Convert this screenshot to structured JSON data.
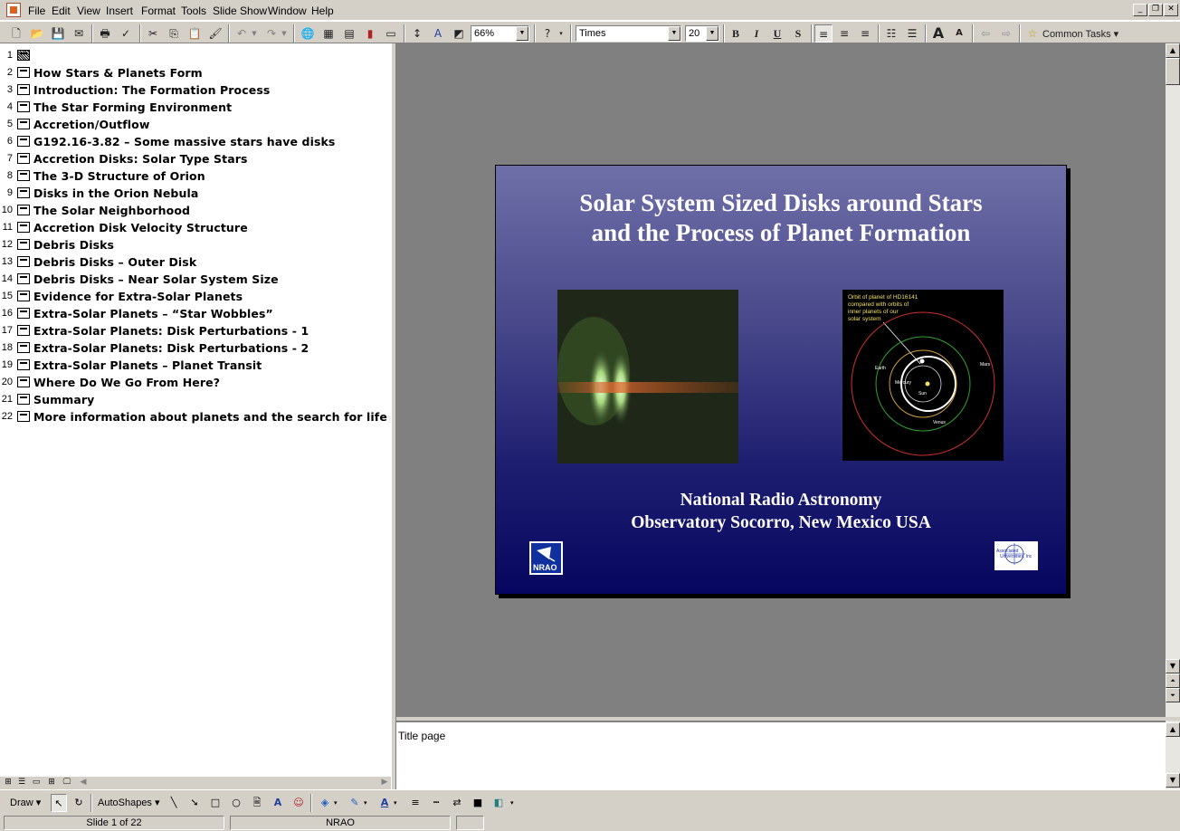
{
  "menubar": {
    "items": [
      "File",
      "Edit",
      "View",
      "Insert",
      "Format",
      "Tools",
      "Slide Show",
      "Window",
      "Help"
    ]
  },
  "toolbar": {
    "zoom": "66%",
    "font_name": "Times",
    "font_size": "20",
    "common_tasks": "Common Tasks"
  },
  "outline": {
    "slides": [
      {
        "num": "1",
        "title": ""
      },
      {
        "num": "2",
        "title": "How Stars & Planets Form"
      },
      {
        "num": "3",
        "title": "Introduction: The Formation Process"
      },
      {
        "num": "4",
        "title": "The Star Forming Environment"
      },
      {
        "num": "5",
        "title": "Accretion/Outflow"
      },
      {
        "num": "6",
        "title": "G192.16-3.82 – Some massive stars have disks"
      },
      {
        "num": "7",
        "title": "Accretion Disks: Solar Type Stars"
      },
      {
        "num": "8",
        "title": "The 3-D Structure of Orion"
      },
      {
        "num": "9",
        "title": "Disks in the Orion Nebula"
      },
      {
        "num": "10",
        "title": "The Solar Neighborhood"
      },
      {
        "num": "11",
        "title": "Accretion Disk Velocity Structure"
      },
      {
        "num": "12",
        "title": "Debris Disks"
      },
      {
        "num": "13",
        "title": "Debris Disks – Outer Disk"
      },
      {
        "num": "14",
        "title": "Debris Disks – Near Solar System Size"
      },
      {
        "num": "15",
        "title": "Evidence for Extra-Solar Planets"
      },
      {
        "num": "16",
        "title": "Extra-Solar Planets – “Star Wobbles”"
      },
      {
        "num": "17",
        "title": "Extra-Solar Planets: Disk Perturbations - 1"
      },
      {
        "num": "18",
        "title": "Extra-Solar Planets: Disk Perturbations - 2"
      },
      {
        "num": "19",
        "title": "Extra-Solar Planets – Planet Transit"
      },
      {
        "num": "20",
        "title": "Where Do We Go From Here?"
      },
      {
        "num": "21",
        "title": "Summary"
      },
      {
        "num": "22",
        "title": "More information about planets and the search for life"
      }
    ]
  },
  "slide": {
    "title_line1": "Solar System Sized Disks around Stars",
    "title_line2": "and the Process of Planet Formation",
    "footer_line1": "National Radio Astronomy",
    "footer_line2": "Observatory Socorro, New Mexico USA",
    "orbit_caption": [
      "Orbit of planet of HD16141",
      "compared with orbits of",
      "inner planets of our",
      "solar system"
    ],
    "orbit_labels": {
      "earth": "Earth",
      "mars": "Mars",
      "mercury": "Mercury",
      "sun": "Sun",
      "venus": "Venus"
    },
    "nrao_logo_text": "NRAO",
    "aui_logo_text": [
      "Associated",
      "Universities, Inc"
    ]
  },
  "notes": {
    "text": "Title page"
  },
  "drawbar": {
    "draw_label": "Draw",
    "autoshapes_label": "AutoShapes"
  },
  "status": {
    "slide_info": "Slide 1 of 22",
    "design": "NRAO"
  },
  "colors": {
    "slide_top": "#6f6fa8",
    "slide_bottom": "#060660",
    "workspace": "#808080",
    "chrome": "#d4d0c8"
  }
}
